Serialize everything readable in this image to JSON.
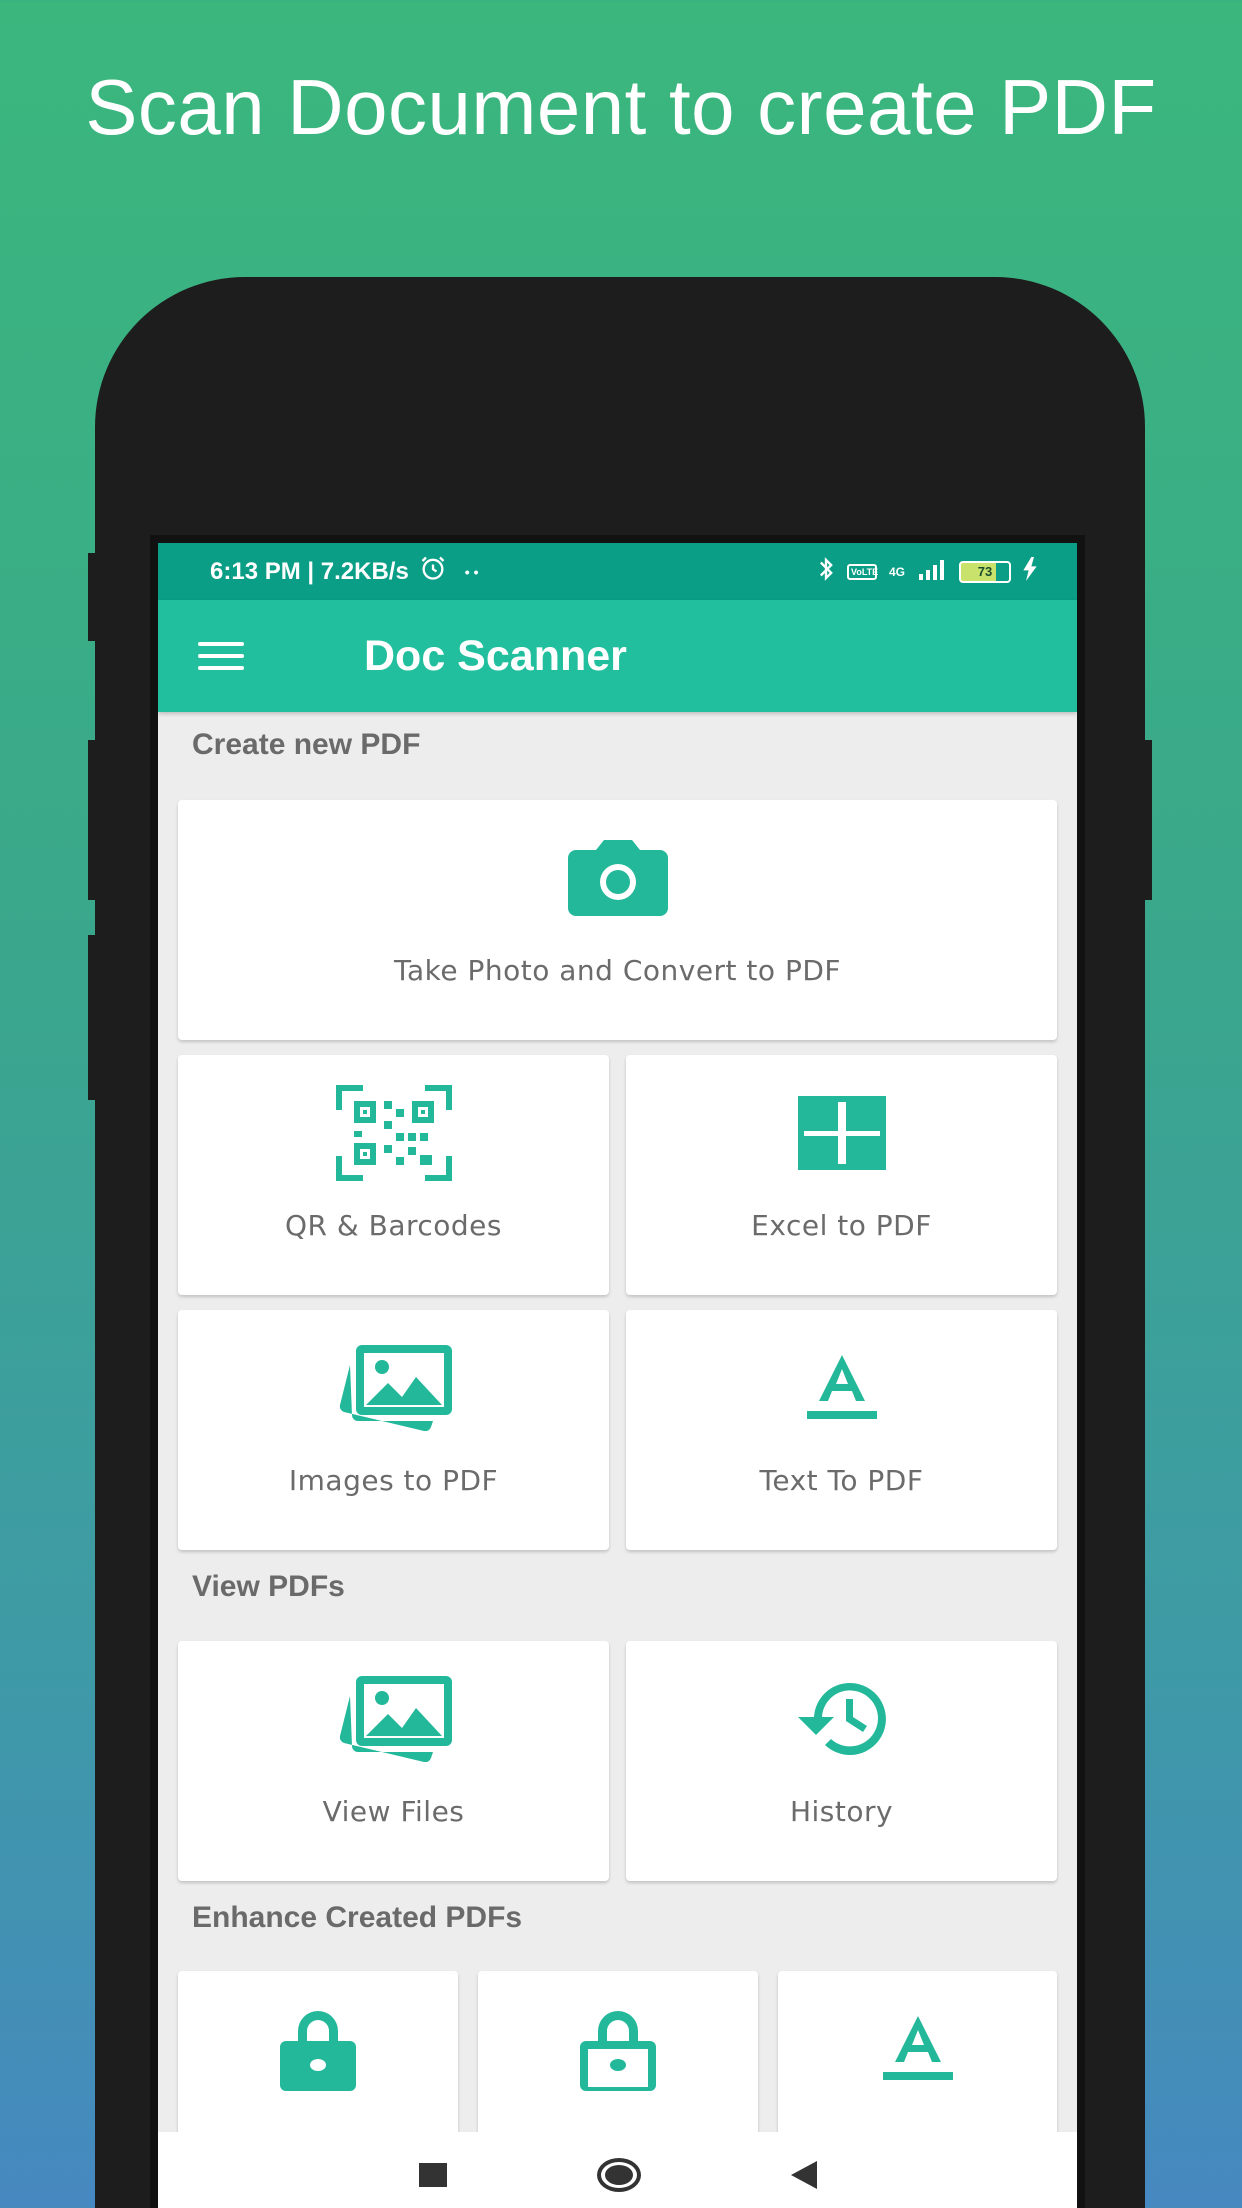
{
  "headline": "Scan Document to create PDF",
  "status_bar": {
    "time_speed": "6:13 PM | 7.2KB/s",
    "dots": "• •",
    "volte": "VoLTE",
    "network": "4G",
    "battery": "73"
  },
  "app_bar": {
    "title": "Doc Scanner"
  },
  "sections": {
    "create": {
      "title": "Create new PDF",
      "take_photo": "Take Photo and Convert to PDF",
      "qr": "QR & Barcodes",
      "excel": "Excel to PDF",
      "images": "Images to PDF",
      "text": "Text To PDF"
    },
    "view": {
      "title": "View PDFs",
      "files": "View Files",
      "history": "History"
    },
    "enhance": {
      "title": "Enhance Created PDFs"
    }
  },
  "icons": {
    "camera": "camera-icon",
    "qr": "qr-code-icon",
    "excel": "grid-icon",
    "images": "images-icon",
    "text": "text-format-icon",
    "history": "history-icon",
    "lock": "lock-icon",
    "unlock": "unlock-icon"
  },
  "colors": {
    "accent": "#22bf9e",
    "status_bar": "#0a9e86",
    "icon": "#23b899"
  }
}
